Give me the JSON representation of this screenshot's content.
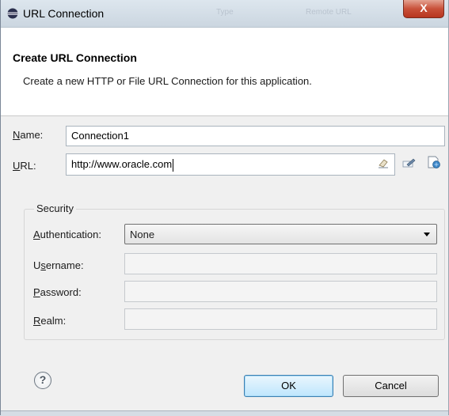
{
  "window": {
    "title": "URL Connection",
    "close_label": "X",
    "background_titles": [
      "Type",
      "Remote URL"
    ]
  },
  "banner": {
    "title": "Create URL Connection",
    "description": "Create a new HTTP or File URL Connection for this application."
  },
  "form": {
    "name": {
      "mnemonic": "N",
      "rest": "ame:",
      "value": "Connection1"
    },
    "url": {
      "mnemonic": "U",
      "rest": "RL:",
      "value": "http://www.oracle.com"
    }
  },
  "security": {
    "legend": "Security",
    "authentication": {
      "mnemonic": "A",
      "rest": "uthentication:",
      "selected": "None"
    },
    "username": {
      "pre": "U",
      "mnemonic": "s",
      "rest": "ername:",
      "value": ""
    },
    "password": {
      "mnemonic": "P",
      "rest": "assword:",
      "value": ""
    },
    "realm": {
      "mnemonic": "R",
      "rest": "ealm:",
      "value": ""
    }
  },
  "footer": {
    "help_glyph": "?",
    "ok_label": "OK",
    "cancel_label": "Cancel"
  },
  "icons": {
    "title": "eclipse-globe-icon",
    "url_clear": "eraser-icon",
    "edit": "edit-pencil-icon",
    "test": "test-connection-icon",
    "help": "help-circle-icon"
  }
}
